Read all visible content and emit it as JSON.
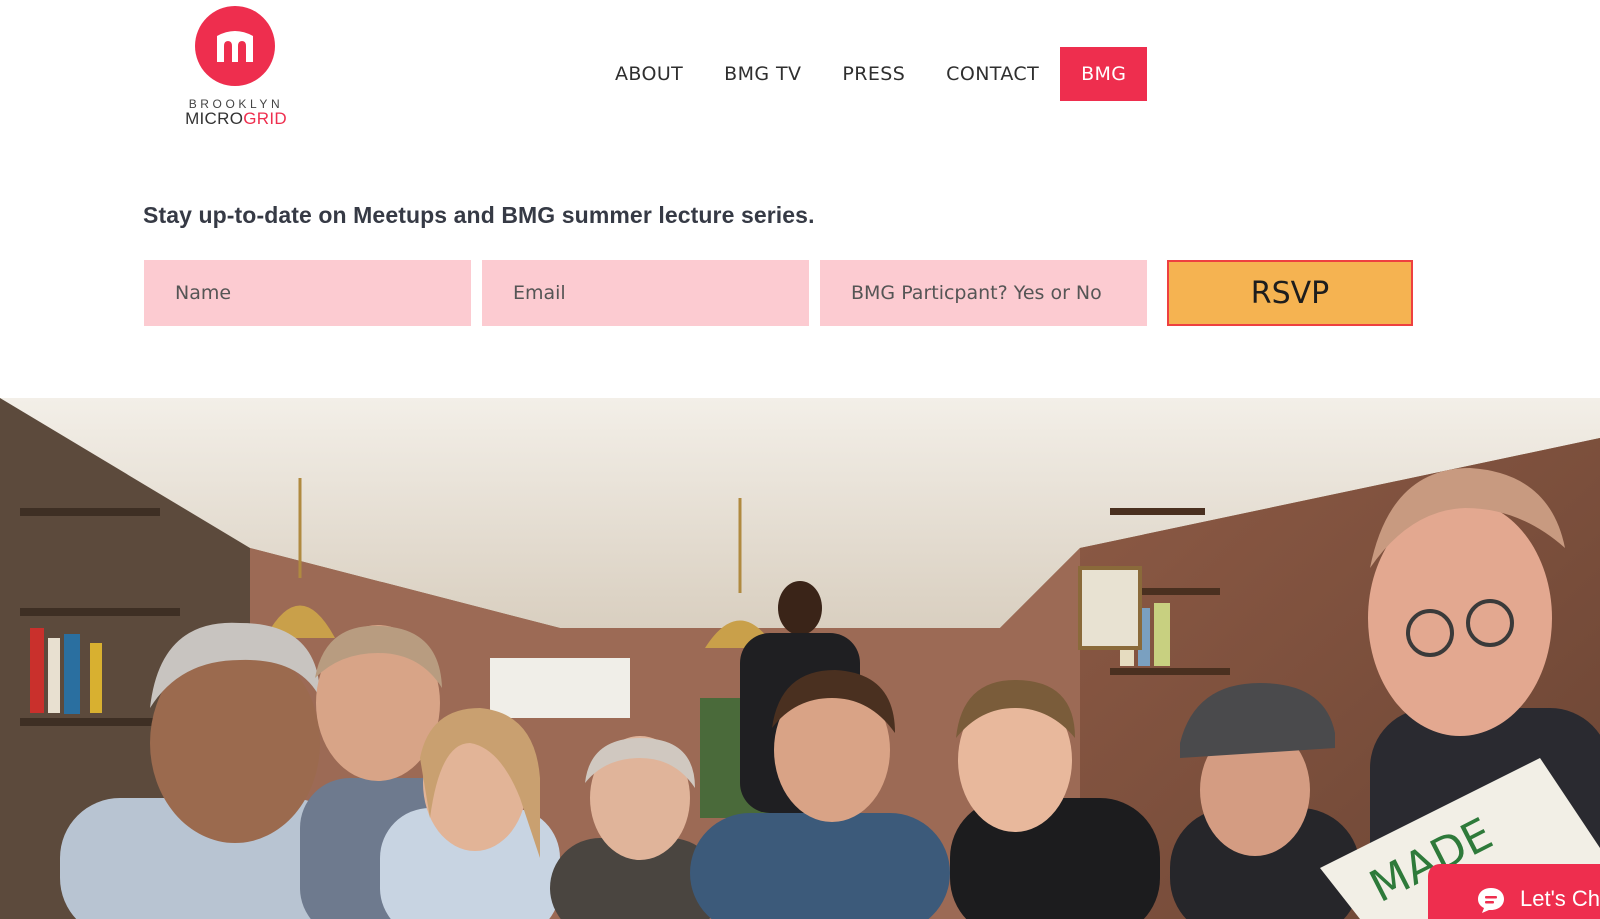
{
  "logo": {
    "line1": "BROOKLYN",
    "line2_a": "MICRO",
    "line2_b": "GRID"
  },
  "nav": {
    "items": [
      {
        "label": "ABOUT"
      },
      {
        "label": "BMG TV"
      },
      {
        "label": "PRESS"
      },
      {
        "label": "CONTACT"
      }
    ],
    "active": {
      "label": "BMG"
    }
  },
  "signup": {
    "headline": "Stay up-to-date on Meetups and BMG summer lecture series.",
    "name_placeholder": "Name",
    "email_placeholder": "Email",
    "participant_placeholder": "BMG Particpant? Yes or No",
    "submit_label": "RSVP"
  },
  "chat": {
    "label": "Let's Ch"
  },
  "colors": {
    "brand": "#ee2e4e",
    "field_bg": "#fccbd1",
    "button_bg": "#f5b351"
  }
}
